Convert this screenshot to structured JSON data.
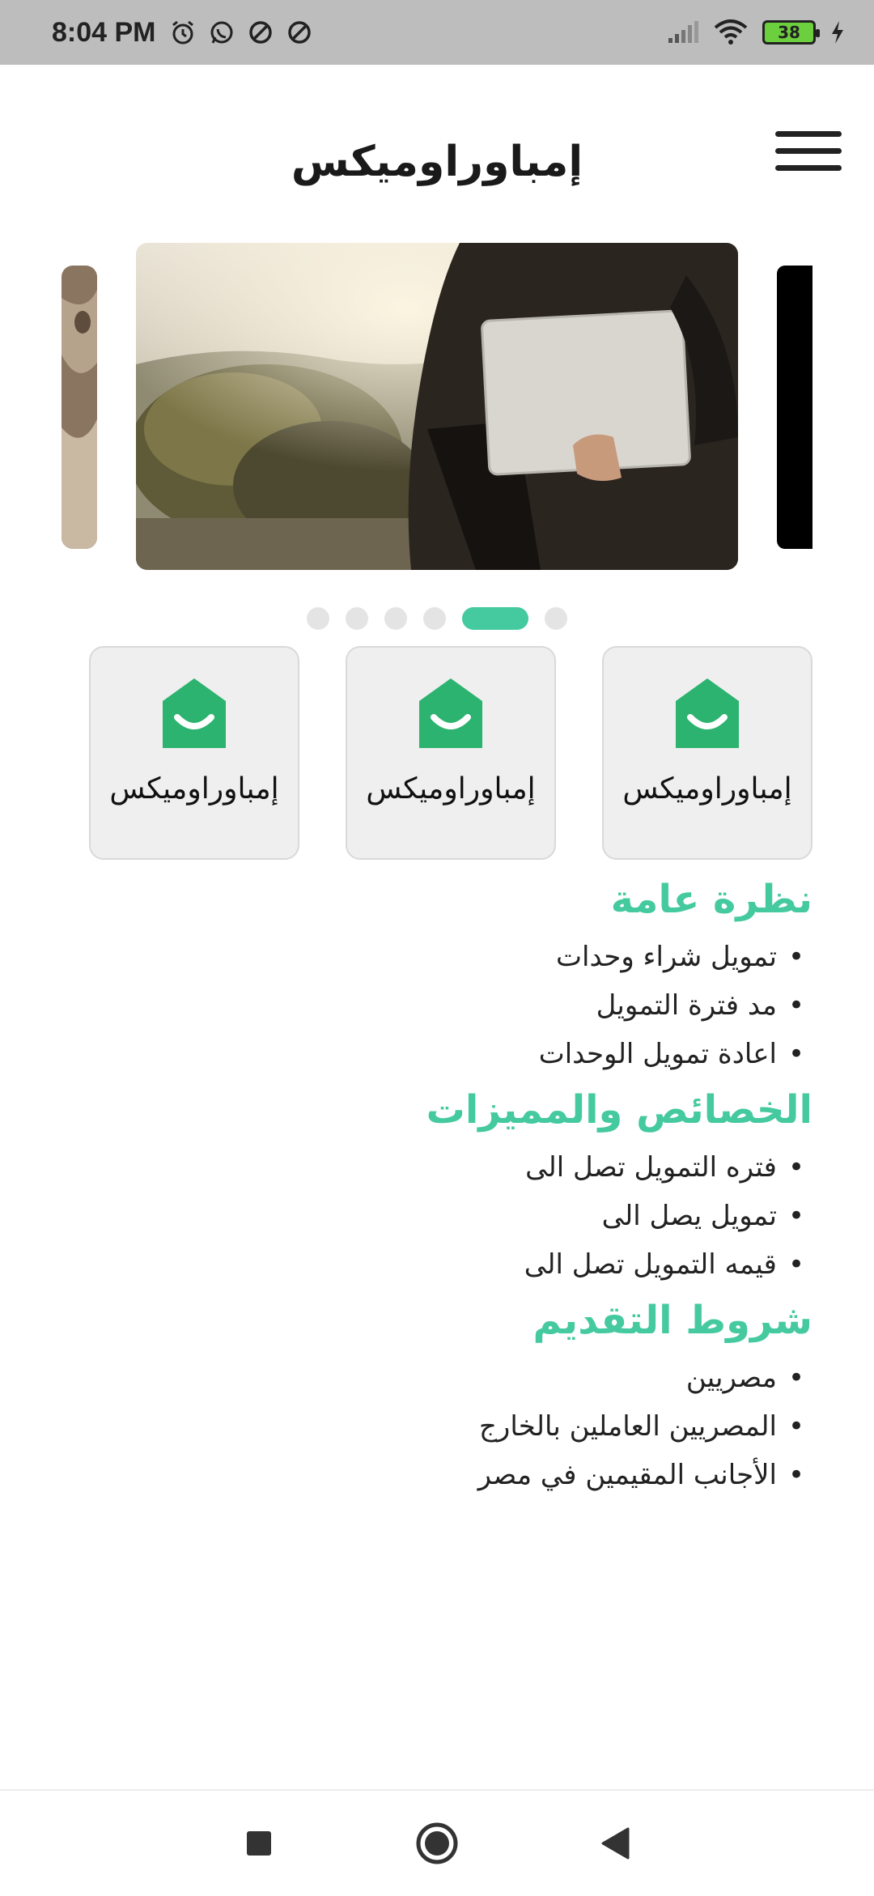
{
  "status_bar": {
    "time": "8:04 PM",
    "battery": "38",
    "left_icons": [
      "alarm-icon",
      "whatsapp-icon",
      "no-disturb-icon",
      "no-disturb-icon"
    ],
    "right_icons": [
      "signal-icon",
      "wifi-icon",
      "battery-icon",
      "charging-icon"
    ]
  },
  "header": {
    "title": "إمباوراوميكس",
    "menu_icon": "hamburger-menu-icon"
  },
  "carousel": {
    "dot_count": 6,
    "active_index": 4
  },
  "cards": [
    {
      "label": "إمباوراوميكس",
      "icon": "smile-house-icon"
    },
    {
      "label": "إمباوراوميكس",
      "icon": "smile-house-icon"
    },
    {
      "label": "إمباوراوميكس",
      "icon": "smile-house-icon"
    }
  ],
  "sections": [
    {
      "title": "نظرة عامة",
      "items": [
        "تمويل شراء وحدات",
        "مد فترة التمويل",
        "اعادة تمويل الوحدات"
      ]
    },
    {
      "title": "الخصائص والمميزات",
      "items": [
        "فتره التمويل تصل الى",
        "تمويل يصل الى",
        "قيمه التمويل تصل الى"
      ]
    },
    {
      "title": "شروط التقديم",
      "items": [
        "مصريين",
        "المصريين العاملين بالخارج",
        "الأجانب المقيمين في مصر"
      ]
    }
  ],
  "colors": {
    "accent": "#45c99f",
    "icon_green": "#2bb36f",
    "status_bar": "#bdbdbd"
  },
  "nav_bar": {
    "buttons": [
      "recents-square-icon",
      "home-circle-icon",
      "back-triangle-icon"
    ]
  }
}
